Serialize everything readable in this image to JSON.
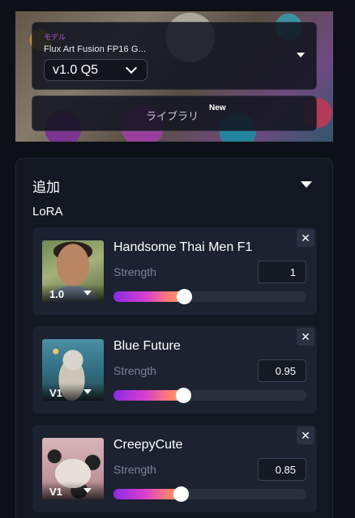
{
  "model": {
    "label": "モデル",
    "name": "Flux Art Fusion FP16 G...",
    "version": "v1.0 Q5"
  },
  "library": {
    "label": "ライブラリ",
    "badge": "New"
  },
  "add_section": {
    "title": "追加",
    "lora_label": "LoRA"
  },
  "loras": [
    {
      "name": "Handsome Thai Men F1",
      "version": "1.0",
      "strength_label": "Strength",
      "strength": "1",
      "slider_fraction": 0.37
    },
    {
      "name": "Blue Future",
      "version": "V1",
      "strength_label": "Strength",
      "strength": "0.95",
      "slider_fraction": 0.365
    },
    {
      "name": "CreepyCute",
      "version": "V1",
      "strength_label": "Strength",
      "strength": "0.85",
      "slider_fraction": 0.355
    }
  ],
  "colors": {
    "background": "#0d1117",
    "panel": "#121722",
    "card": "#1c2230",
    "accent_label": "#b15ce0",
    "slider_gradient_start": "#8a2be2",
    "slider_gradient_end": "#ffa070"
  },
  "icons": {
    "dropdown": "caret-down-icon",
    "close": "close-icon",
    "chevron": "chevron-down-icon"
  }
}
